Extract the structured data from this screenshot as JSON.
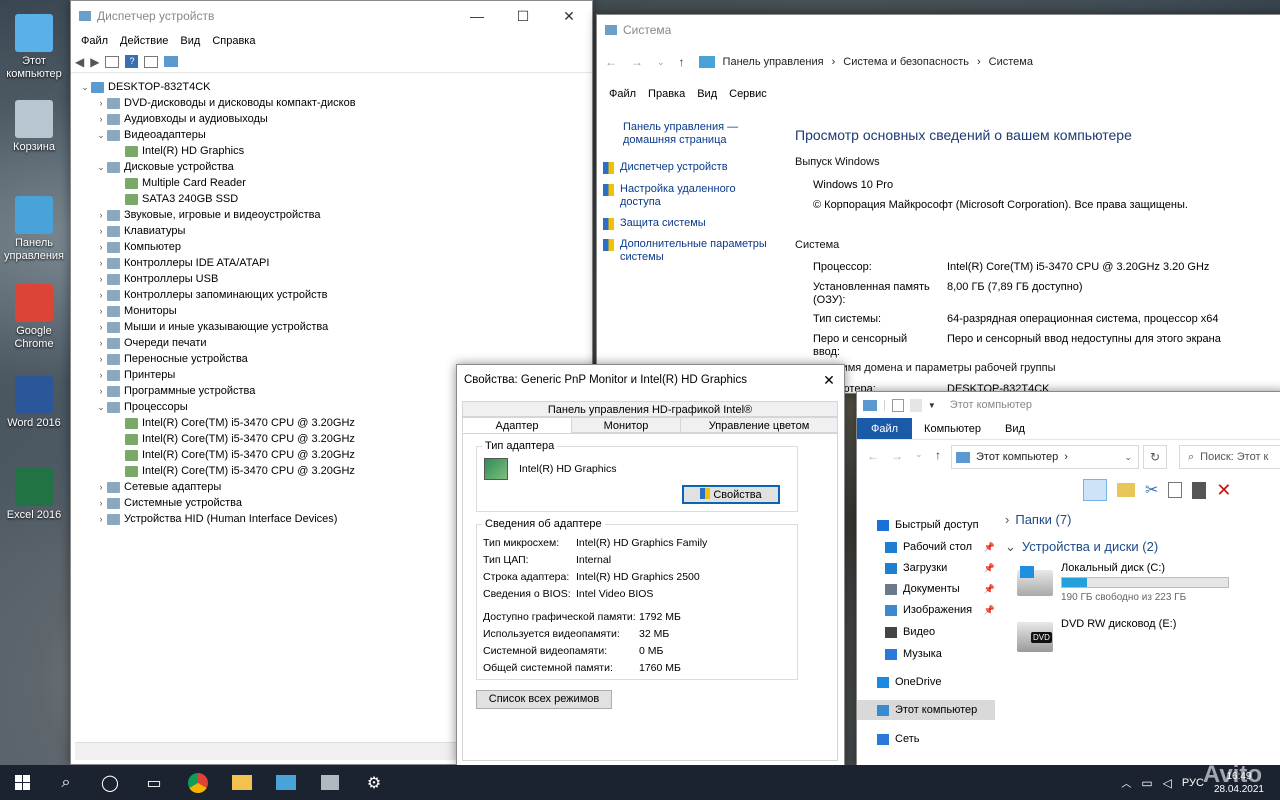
{
  "desktop": {
    "icons": [
      {
        "label": "Этот компьютер",
        "color": "#5ab0e8"
      },
      {
        "label": "Корзина",
        "color": "#b8c6d1"
      },
      {
        "label": "Панель управления",
        "color": "#4aa3d8"
      },
      {
        "label": "Google Chrome",
        "color": "#db4437"
      },
      {
        "label": "Word 2016",
        "color": "#2b579a"
      },
      {
        "label": "Excel 2016",
        "color": "#217346"
      }
    ]
  },
  "devmgr": {
    "title": "Диспетчер устройств",
    "menu": [
      "Файл",
      "Действие",
      "Вид",
      "Справка"
    ],
    "root": "DESKTOP-832T4CK",
    "rows": [
      {
        "label": "DVD-дисководы и дисководы компакт-дисков",
        "level": 1,
        "arrow": "›"
      },
      {
        "label": "Аудиовходы и аудиовыходы",
        "level": 1,
        "arrow": "›"
      },
      {
        "label": "Видеоадаптеры",
        "level": 1,
        "arrow": "⌄"
      },
      {
        "label": "Intel(R) HD Graphics",
        "level": 2,
        "arrow": ""
      },
      {
        "label": "Дисковые устройства",
        "level": 1,
        "arrow": "⌄"
      },
      {
        "label": "Multiple Card Reader",
        "level": 2,
        "arrow": ""
      },
      {
        "label": "SATA3 240GB SSD",
        "level": 2,
        "arrow": ""
      },
      {
        "label": "Звуковые, игровые и видеоустройства",
        "level": 1,
        "arrow": "›"
      },
      {
        "label": "Клавиатуры",
        "level": 1,
        "arrow": "›"
      },
      {
        "label": "Компьютер",
        "level": 1,
        "arrow": "›"
      },
      {
        "label": "Контроллеры IDE ATA/ATAPI",
        "level": 1,
        "arrow": "›"
      },
      {
        "label": "Контроллеры USB",
        "level": 1,
        "arrow": "›"
      },
      {
        "label": "Контроллеры запоминающих устройств",
        "level": 1,
        "arrow": "›"
      },
      {
        "label": "Мониторы",
        "level": 1,
        "arrow": "›"
      },
      {
        "label": "Мыши и иные указывающие устройства",
        "level": 1,
        "arrow": "›"
      },
      {
        "label": "Очереди печати",
        "level": 1,
        "arrow": "›"
      },
      {
        "label": "Переносные устройства",
        "level": 1,
        "arrow": "›"
      },
      {
        "label": "Принтеры",
        "level": 1,
        "arrow": "›"
      },
      {
        "label": "Программные устройства",
        "level": 1,
        "arrow": "›"
      },
      {
        "label": "Процессоры",
        "level": 1,
        "arrow": "⌄"
      },
      {
        "label": "Intel(R) Core(TM) i5-3470 CPU @ 3.20GHz",
        "level": 2,
        "arrow": ""
      },
      {
        "label": "Intel(R) Core(TM) i5-3470 CPU @ 3.20GHz",
        "level": 2,
        "arrow": ""
      },
      {
        "label": "Intel(R) Core(TM) i5-3470 CPU @ 3.20GHz",
        "level": 2,
        "arrow": ""
      },
      {
        "label": "Intel(R) Core(TM) i5-3470 CPU @ 3.20GHz",
        "level": 2,
        "arrow": ""
      },
      {
        "label": "Сетевые адаптеры",
        "level": 1,
        "arrow": "›"
      },
      {
        "label": "Системные устройства",
        "level": 1,
        "arrow": "›"
      },
      {
        "label": "Устройства HID (Human Interface Devices)",
        "level": 1,
        "arrow": "›"
      }
    ]
  },
  "system": {
    "title": "Система",
    "breadcrumb": [
      "Панель управления",
      "Система и безопасность",
      "Система"
    ],
    "menu": [
      "Файл",
      "Правка",
      "Вид",
      "Сервис"
    ],
    "side_home": "Панель управления — домашняя страница",
    "side_links": [
      "Диспетчер устройств",
      "Настройка удаленного доступа",
      "Защита системы",
      "Дополнительные параметры системы"
    ],
    "heading": "Просмотр основных сведений о вашем компьютере",
    "edition_title": "Выпуск Windows",
    "edition": "Windows 10 Pro",
    "copyright": "© Корпорация Майкрософт (Microsoft Corporation). Все права защищены.",
    "system_title": "Система",
    "rows": [
      {
        "k": "Процессор:",
        "v": "Intel(R) Core(TM) i5-3470 CPU @ 3.20GHz   3.20 GHz"
      },
      {
        "k": "Установленная память (ОЗУ):",
        "v": "8,00 ГБ (7,89 ГБ доступно)"
      },
      {
        "k": "Тип системы:",
        "v": "64-разрядная операционная система, процессор x64"
      },
      {
        "k": "Перо и сенсорный ввод:",
        "v": "Перо и сенсорный ввод недоступны для этого экрана"
      }
    ],
    "partial_title": "...ютера, имя домена и параметры рабочей группы",
    "partial_k": "...мпьютера:",
    "partial_v": "DESKTOP-832T4CK"
  },
  "props": {
    "title": "Свойства: Generic PnP Monitor и Intel(R) HD Graphics",
    "top_tab": "Панель управления HD-графикой Intel®",
    "tabs": [
      "Адаптер",
      "Монитор",
      "Управление цветом"
    ],
    "adapter_type_label": "Тип адаптера",
    "adapter_name": "Intel(R) HD Graphics",
    "props_button": "Свойства",
    "info_label": "Сведения об адаптере",
    "info": [
      {
        "k": "Тип микросхем:",
        "v": "Intel(R) HD Graphics Family"
      },
      {
        "k": "Тип ЦАП:",
        "v": "Internal"
      },
      {
        "k": "Строка адаптера:",
        "v": "Intel(R) HD Graphics 2500"
      },
      {
        "k": "Сведения о BIOS:",
        "v": "Intel Video BIOS"
      }
    ],
    "mem": [
      {
        "k": "Доступно графической памяти:",
        "v": "1792 МБ"
      },
      {
        "k": "Используется видеопамяти:",
        "v": "32 МБ"
      },
      {
        "k": "Системной видеопамяти:",
        "v": "0 МБ"
      },
      {
        "k": "Общей системной памяти:",
        "v": "1760 МБ"
      }
    ],
    "modes_button": "Список всех режимов"
  },
  "explorer": {
    "title": "Этот компьютер",
    "ribbon_tabs": [
      "Файл",
      "Компьютер",
      "Вид"
    ],
    "address": "Этот компьютер",
    "search": "Поиск: Этот к",
    "nav": [
      {
        "label": "Быстрый доступ",
        "pin": false
      },
      {
        "label": "Рабочий стол",
        "pin": true
      },
      {
        "label": "Загрузки",
        "pin": true
      },
      {
        "label": "Документы",
        "pin": true
      },
      {
        "label": "Изображения",
        "pin": true
      },
      {
        "label": "Видео",
        "pin": false
      },
      {
        "label": "Музыка",
        "pin": false
      },
      {
        "label": "OneDrive",
        "pin": false
      },
      {
        "label": "Этот компьютер",
        "pin": false
      },
      {
        "label": "Сеть",
        "pin": false
      }
    ],
    "folders_group": "Папки (7)",
    "drives_group": "Устройства и диски (2)",
    "drive_c": {
      "name": "Локальный диск (C:)",
      "free": "190 ГБ свободно из 223 ГБ",
      "used_fraction": 0.148
    },
    "drive_e": {
      "name": "DVD RW дисковод (E:)",
      "badge": "DVD"
    }
  },
  "taskbar": {
    "lang": "РУС",
    "time": "16:49",
    "date": "28.04.2021",
    "watermark": "Avito"
  }
}
